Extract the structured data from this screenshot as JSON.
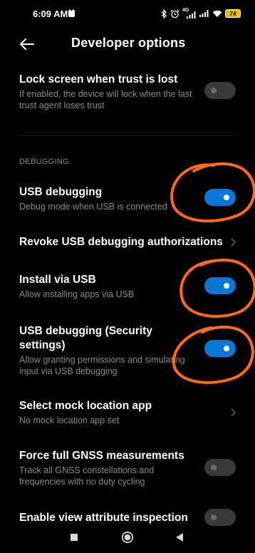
{
  "status": {
    "time": "6:09 AM",
    "battery": "74",
    "network": "4G"
  },
  "header": {
    "title": "Developer options"
  },
  "rows": {
    "lock_screen": {
      "title": "Lock screen when trust is lost",
      "subtitle": "If enabled, the device will lock when the last trust agent loses trust",
      "toggle": false
    },
    "section_debugging": "DEBUGGING",
    "usb_debugging": {
      "title": "USB debugging",
      "subtitle": "Debug mode when USB is connected",
      "toggle": true
    },
    "revoke": {
      "title": "Revoke USB debugging authorizations"
    },
    "install_usb": {
      "title": "Install via USB",
      "subtitle": "Allow installing apps via USB",
      "toggle": true
    },
    "usb_security": {
      "title_line1": "USB debugging (Security",
      "title_line2": "settings)",
      "subtitle_line1": "Allow granting permissions and simulating",
      "subtitle_line2": "input via USB debugging",
      "toggle": true
    },
    "mock_location": {
      "title": "Select mock location app",
      "subtitle": "No mock location app set"
    },
    "gnss": {
      "title": "Force full GNSS measurements",
      "subtitle_line1": "Track all GNSS constellations and",
      "subtitle_line2": "frequencies with no duty cycling",
      "toggle": false
    },
    "view_attr": {
      "title": "Enable view attribute inspection",
      "toggle": false
    }
  },
  "colors": {
    "background": "#000000",
    "toggle_on": "#0a76d6",
    "toggle_off": "#3a3a3a",
    "annotation": "#ff6a1a",
    "battery": "#f5b800"
  },
  "icons": [
    "back-arrow-icon",
    "chevron-right-icon",
    "bluetooth-icon",
    "alarm-icon",
    "signal-icon",
    "wifi-icon",
    "battery-icon",
    "recents-icon",
    "home-icon",
    "back-nav-icon"
  ]
}
